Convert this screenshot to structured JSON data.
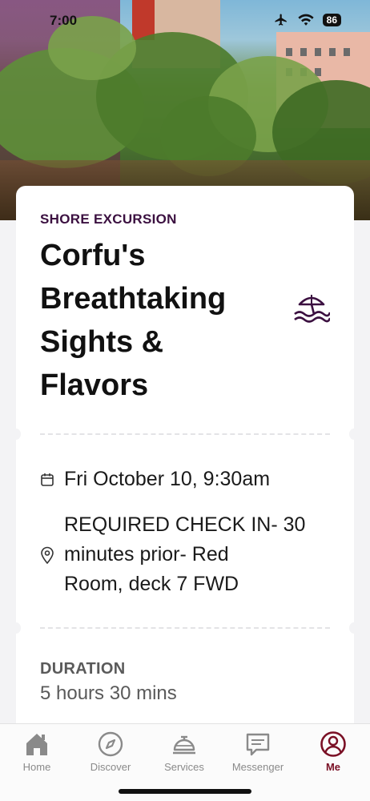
{
  "status_bar": {
    "time": "7:00",
    "battery": "86"
  },
  "excursion": {
    "category": "SHORE EXCURSION",
    "title_lines": [
      "Corfu's",
      "Breathtaking",
      "Sights &",
      "Flavors"
    ],
    "date": "Fri October 10, 9:30am",
    "location_lines": [
      "REQUIRED CHECK IN- 30",
      "minutes prior- Red",
      "Room, deck 7 FWD"
    ],
    "duration_label": "DURATION",
    "duration_value": "5 hours 30 mins"
  },
  "icons": {
    "category": "beach-umbrella-icon",
    "date": "calendar-icon",
    "location": "location-pin-icon"
  },
  "tabs": [
    {
      "label": "Home",
      "icon": "home-icon",
      "active": false
    },
    {
      "label": "Discover",
      "icon": "compass-icon",
      "active": false
    },
    {
      "label": "Services",
      "icon": "service-bell-icon",
      "active": false
    },
    {
      "label": "Messenger",
      "icon": "chat-icon",
      "active": false
    },
    {
      "label": "Me",
      "icon": "profile-icon",
      "active": true
    }
  ],
  "colors": {
    "accent": "#7a1025",
    "eyebrow": "#3b1040",
    "icon_gray": "#8a8a8a"
  }
}
